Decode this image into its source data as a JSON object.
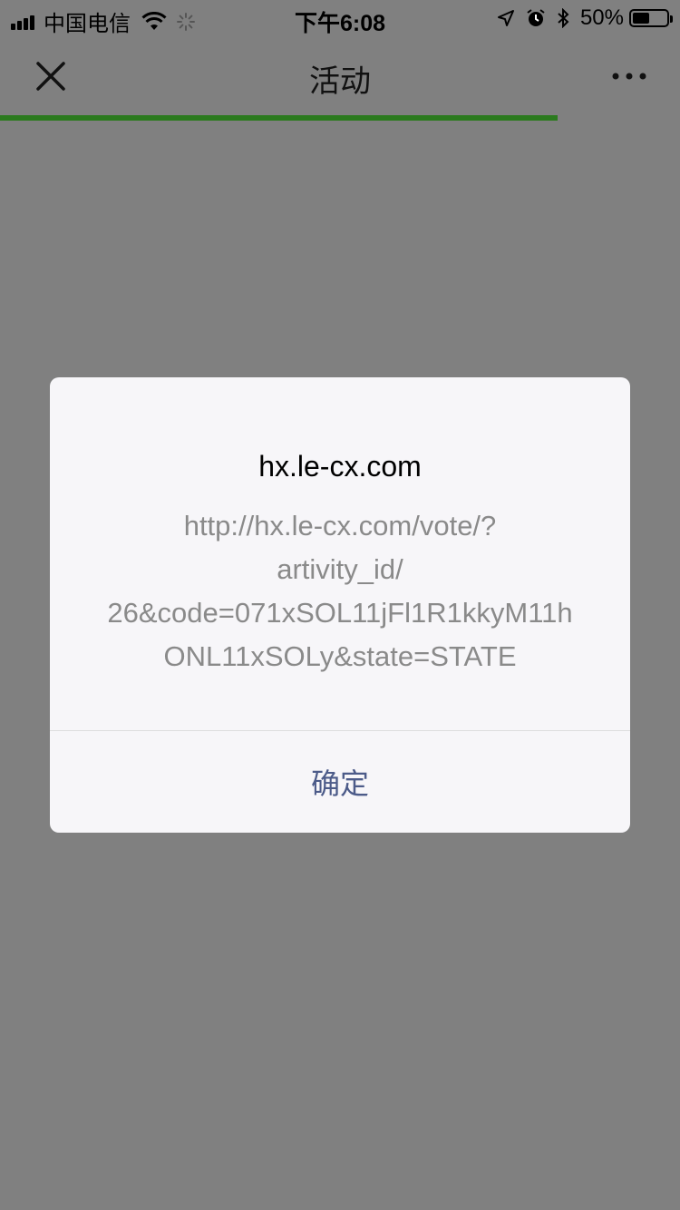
{
  "status_bar": {
    "carrier": "中国电信",
    "time": "下午6:08",
    "battery_percent": "50%",
    "battery_level": 0.5,
    "icons": [
      "signal-icon",
      "wifi-icon",
      "loading-icon",
      "location-icon",
      "alarm-icon",
      "bluetooth-icon",
      "battery-icon"
    ]
  },
  "nav": {
    "title": "活动",
    "close_icon": "close-icon",
    "more_icon": "more-icon",
    "page_load_progress": 0.82,
    "accent_color": "#2b7a1e"
  },
  "dialog": {
    "title": "hx.le-cx.com",
    "message_lines": [
      "http://hx.le-cx.com/vote/?",
      "artivity_id/",
      "26&code=071xSOL11jFl1R1kkyM11h",
      "ONL11xSOLy&state=STATE"
    ],
    "confirm_label": "确定",
    "button_color": "#4c5b89"
  }
}
